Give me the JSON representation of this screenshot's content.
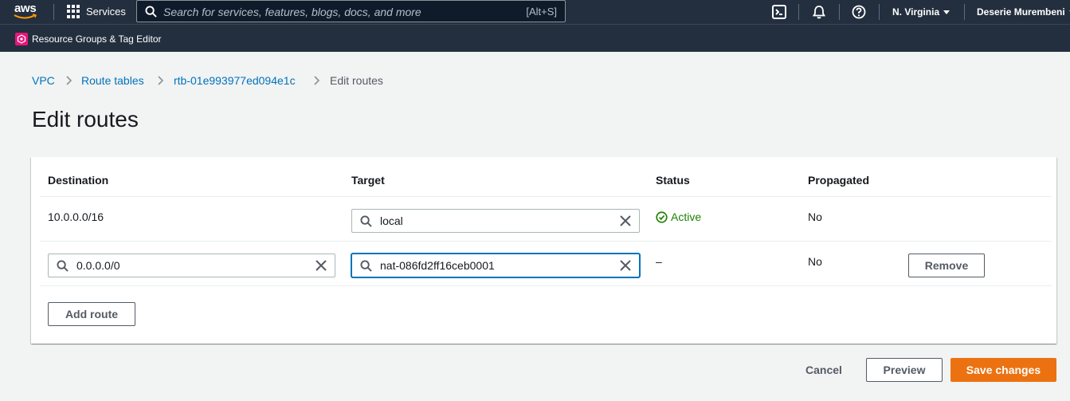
{
  "nav": {
    "logo_text": "aws",
    "services_label": "Services",
    "search_placeholder": "Search for services, features, blogs, docs, and more",
    "search_shortcut": "[Alt+S]",
    "region": "N. Virginia",
    "user": "Deserie Murembeni"
  },
  "favorites": {
    "item_label": "Resource Groups & Tag Editor"
  },
  "breadcrumb": {
    "items": [
      "VPC",
      "Route tables",
      "rtb-01e993977ed094e1c",
      "Edit routes"
    ]
  },
  "page": {
    "title": "Edit routes"
  },
  "table": {
    "columns": [
      "Destination",
      "Target",
      "Status",
      "Propagated"
    ],
    "rows": [
      {
        "destination": "10.0.0.0/16",
        "target": "local",
        "status": "Active",
        "propagated": "No"
      },
      {
        "destination": "0.0.0.0/0",
        "target": "nat-086fd2ff16ceb0001",
        "status": "–",
        "propagated": "No",
        "remove_label": "Remove"
      }
    ],
    "add_route_label": "Add route"
  },
  "actions": {
    "cancel": "Cancel",
    "preview": "Preview",
    "save": "Save changes"
  },
  "colors": {
    "nav_bg": "#232f3e",
    "link": "#0073bb",
    "primary": "#ec7211",
    "success": "#1d8102"
  }
}
